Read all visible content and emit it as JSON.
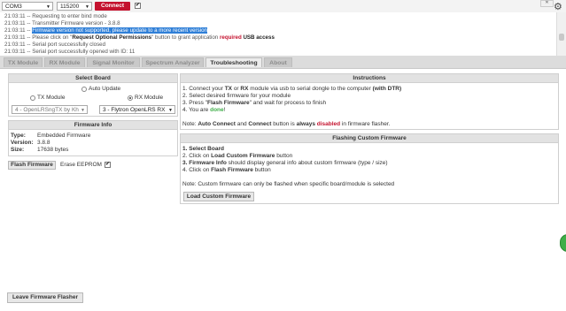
{
  "toolbar": {
    "port": "COM3",
    "baud": "115200",
    "connect_label": "Connect",
    "auto_connect_checked": "✔"
  },
  "log": [
    {
      "pre": "21:03:11 -- ",
      "text": "Requesting to enter bind mode"
    },
    {
      "pre": "21:03:11 -- ",
      "text": "Transmitter Firmware version - 3.8.8"
    },
    {
      "pre": "21:03:11 -- ",
      "hl": "Firmware version not supported, please update to a more recent version"
    },
    {
      "pre": "21:03:11 -- ",
      "text_a": "Please click on \"",
      "bold": "Request Optional Permissions",
      "text_b": "\" button to grant application ",
      "red": "required",
      "text_c": " USB access"
    },
    {
      "pre": "21:03:11 -- ",
      "text": "Serial port successfully closed"
    },
    {
      "pre": "21:03:11 -- ",
      "text": "Serial port successfully opened with ID: 11"
    }
  ],
  "tabs": [
    {
      "label": "TX Module"
    },
    {
      "label": "RX Module"
    },
    {
      "label": "Signal Monitor"
    },
    {
      "label": "Spectrum Analyzer"
    },
    {
      "label": "Troubleshooting"
    },
    {
      "label": "About"
    }
  ],
  "select_board": {
    "title": "Select Board",
    "auto_update": "Auto Update",
    "tx_module": "TX Module",
    "rx_module": "RX Module",
    "tx_select": "4 - OpenLRSngTX by Kh",
    "rx_select": "3 - Flytron OpenLRS RX"
  },
  "firmware_info": {
    "title": "Firmware Info",
    "type_label": "Type:",
    "type_value": "Embedded Firmware",
    "version_label": "Version:",
    "version_value": "3.8.8",
    "size_label": "Size:",
    "size_value": "17638 bytes"
  },
  "flash": {
    "button": "Flash Firmware",
    "eeprom_label": "Erase EEPROM",
    "eeprom_checked": "✔"
  },
  "leave_button": "Leave Firmware Flasher",
  "instructions": {
    "title": "Instructions",
    "steps": [
      {
        "a": "1. Connect your ",
        "b1": "TX",
        "a2": " or ",
        "b2": "RX",
        "a3": " module via usb to serial dongle to the computer ",
        "b3": "(with DTR)"
      },
      {
        "a": "2. Select desired firmware for your module"
      },
      {
        "a": "3. Press \"",
        "b1": "Flash Firmware",
        "a2": "\" and wait for process to finish"
      },
      {
        "a": "4. You are ",
        "g": "done",
        "a2": "!"
      }
    ],
    "note_a": "Note: ",
    "note_b1": "Auto Connect",
    "note_b": " and ",
    "note_b2": "Connect",
    "note_c": " button is ",
    "note_always": "always",
    "note_disabled": "disabled",
    "note_d": " in firmware flasher."
  },
  "custom_fw": {
    "title": "Flashing Custom Firmware",
    "steps": [
      {
        "b": "1. Select Board",
        "a": ""
      },
      {
        "b": "",
        "a": "2. Click on ",
        "b2": "Load Custom Firmware",
        "a2": " button"
      },
      {
        "b": "3. Firmware Info",
        "a": " should display general info about custom firmware (type / size)"
      },
      {
        "b": "",
        "a": "4. Click on ",
        "b2": "Flash Firmware",
        "a2": " button"
      }
    ],
    "note": "Note: Custom firmware can only be flashed when specific board/module is selected",
    "load_button": "Load Custom Firmware"
  }
}
